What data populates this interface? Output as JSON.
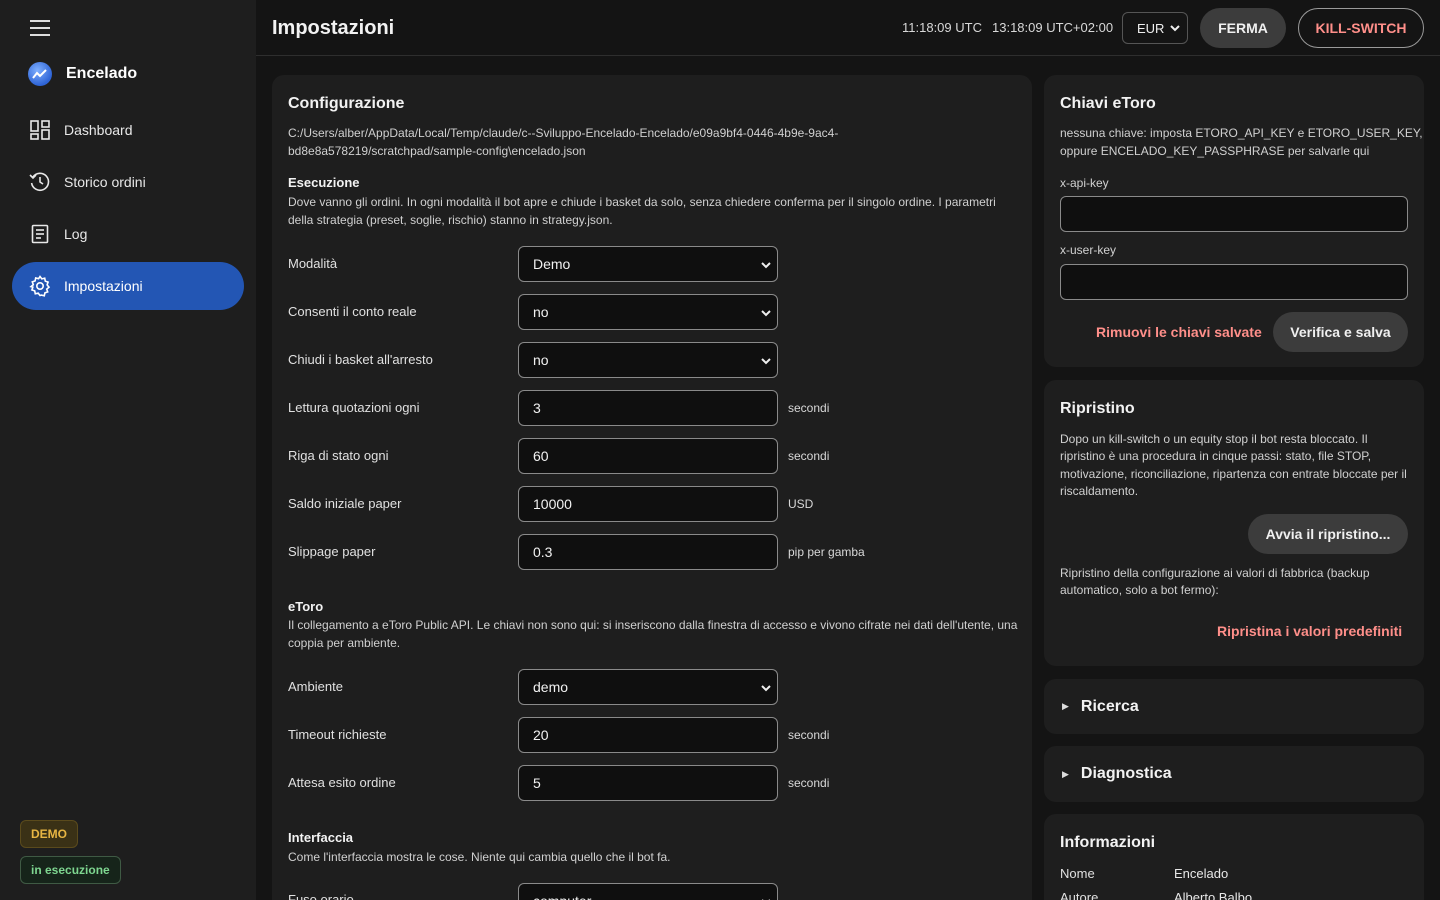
{
  "sidebar": {
    "brand": "Encelado",
    "items": [
      {
        "label": "Dashboard",
        "icon": "dashboard-icon"
      },
      {
        "label": "Storico ordini",
        "icon": "history-icon"
      },
      {
        "label": "Log",
        "icon": "log-icon"
      },
      {
        "label": "Impostazioni",
        "icon": "gear-icon",
        "active": true
      }
    ],
    "badge_mode": "DEMO",
    "badge_status": "in esecuzione"
  },
  "header": {
    "title": "Impostazioni",
    "clock_utc": "11:18:09 UTC",
    "clock_local": "13:18:09 UTC+02:00",
    "currency": "EUR",
    "stop_label": "FERMA",
    "kill_label": "KILL-SWITCH"
  },
  "config": {
    "title": "Configurazione",
    "path_line1": "C:/Users/alber/AppData/Local/Temp/claude/c--Sviluppo-Encelado-Encelado/e09a9bf4-0446-4b9e-9ac4-",
    "path_line2": "bd8e8a578219/scratchpad/sample-config\\encelado.json",
    "execution": {
      "title": "Esecuzione",
      "desc_line1": "Dove vanno gli ordini. In ogni modalità il bot apre e chiude i basket da solo, senza chiedere conferma per il singolo ordine. I parametri",
      "desc_line2": "della strategia (preset, soglie, rischio) stanno in strategy.json.",
      "rows": [
        {
          "label": "Modalità",
          "value": "Demo",
          "type": "select",
          "unit": ""
        },
        {
          "label": "Consenti il conto reale",
          "value": "no",
          "type": "select",
          "unit": ""
        },
        {
          "label": "Chiudi i basket all'arresto",
          "value": "no",
          "type": "select",
          "unit": ""
        },
        {
          "label": "Lettura quotazioni ogni",
          "value": "3",
          "type": "input",
          "unit": "secondi"
        },
        {
          "label": "Riga di stato ogni",
          "value": "60",
          "type": "input",
          "unit": "secondi"
        },
        {
          "label": "Saldo iniziale paper",
          "value": "10000",
          "type": "input",
          "unit": "USD"
        },
        {
          "label": "Slippage paper",
          "value": "0.3",
          "type": "input",
          "unit": "pip per gamba"
        }
      ]
    },
    "etoro": {
      "title": "eToro",
      "desc_line1": "Il collegamento a eToro Public API. Le chiavi non sono qui: si inseriscono dalla finestra di accesso e vivono cifrate nei dati dell'utente, una",
      "desc_line2": "coppia per ambiente.",
      "rows": [
        {
          "label": "Ambiente",
          "value": "demo",
          "type": "select",
          "unit": ""
        },
        {
          "label": "Timeout richieste",
          "value": "20",
          "type": "input",
          "unit": "secondi"
        },
        {
          "label": "Attesa esito ordine",
          "value": "5",
          "type": "input",
          "unit": "secondi"
        }
      ]
    },
    "interface": {
      "title": "Interfaccia",
      "desc": "Come l'interfaccia mostra le cose. Niente qui cambia quello che il bot fa.",
      "rows": [
        {
          "label": "Fuso orario",
          "value": "computer",
          "type": "select",
          "unit": ""
        }
      ]
    }
  },
  "keys": {
    "title": "Chiavi eToro",
    "desc_line1": "nessuna chiave: imposta ETORO_API_KEY e ETORO_USER_KEY,",
    "desc_line2": "oppure ENCELADO_KEY_PASSPHRASE per salvarle qui",
    "api_label": "x-api-key",
    "api_value": "",
    "user_label": "x-user-key",
    "user_value": "",
    "remove_label": "Rimuovi le chiavi salvate",
    "save_label": "Verifica e salva"
  },
  "restore": {
    "title": "Ripristino",
    "desc_lines": [
      "Dopo un kill-switch o un equity stop il bot resta bloccato. Il",
      "ripristino è una procedura in cinque passi: stato, file STOP,",
      "motivazione, riconciliazione, ripartenza con entrate bloccate per il",
      "riscaldamento."
    ],
    "start_label": "Avvia il ripristino...",
    "factory_line1": "Ripristino della configurazione ai valori di fabbrica (backup",
    "factory_line2": "automatico, solo a bot fermo):",
    "defaults_label": "Ripristina i valori predefiniti"
  },
  "research": {
    "label": "Ricerca"
  },
  "diagnostics": {
    "label": "Diagnostica"
  },
  "info": {
    "title": "Informazioni",
    "rows": [
      {
        "key": "Nome",
        "value": "Encelado"
      },
      {
        "key": "Autore",
        "value": "Alberto Balbo"
      }
    ]
  },
  "colors": {
    "background": "#141414",
    "surface": "#1e1e1e",
    "accent": "#2356b4",
    "danger": "#ff8f8a",
    "demo_badge": "#e7b543",
    "running_badge": "#7ed690"
  }
}
